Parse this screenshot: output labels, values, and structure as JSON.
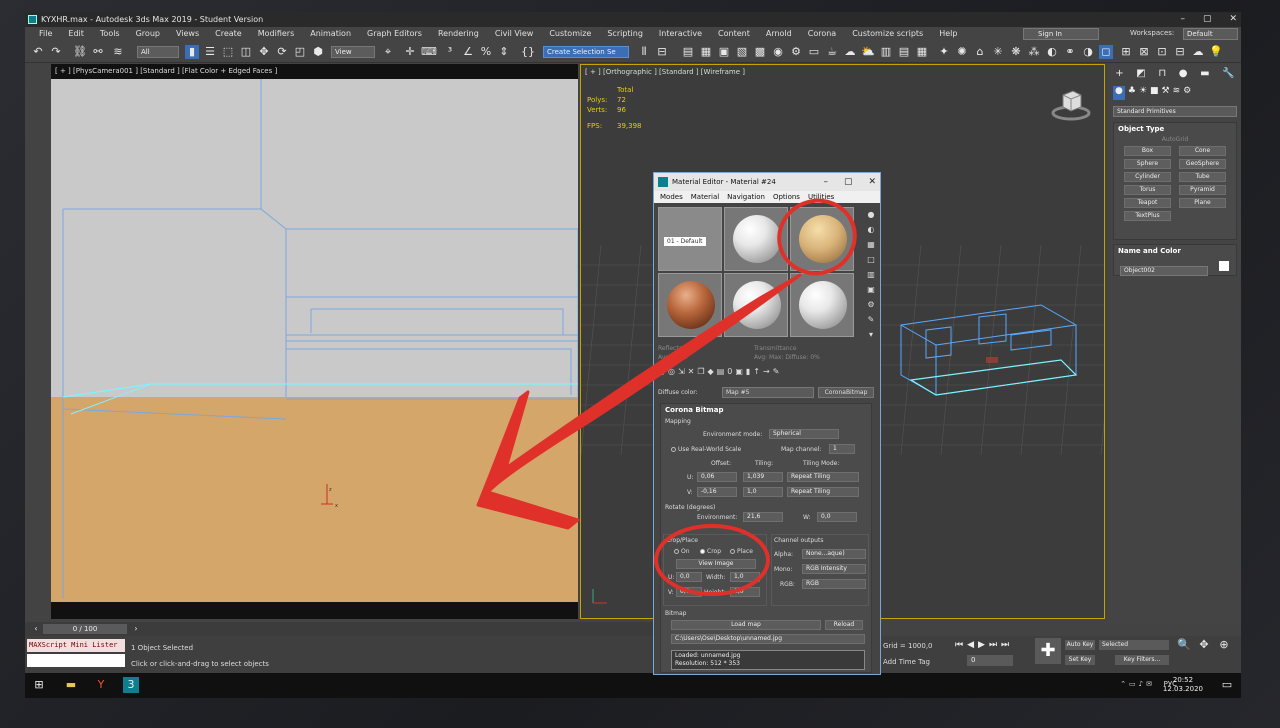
{
  "window": {
    "title": "KYXHR.max - Autodesk 3ds Max 2019 - Student Version",
    "minimize": "–",
    "maximize": "▢",
    "close": "✕"
  },
  "menu": [
    "File",
    "Edit",
    "Tools",
    "Group",
    "Views",
    "Create",
    "Modifiers",
    "Animation",
    "Graph Editors",
    "Rendering",
    "Civil View",
    "Customize",
    "Scripting",
    "Interactive",
    "Content",
    "Arnold",
    "Corona",
    "Customize scripts",
    "Help"
  ],
  "account": {
    "sign_in": "Sign In",
    "workspaces_label": "Workspaces:",
    "workspace": "Default"
  },
  "toolbar": {
    "filter": "All",
    "view": "View",
    "selection_set": "Create Selection Se"
  },
  "viewport_left": {
    "label": "[ + ] [PhysCamera001 ] [Standard ] [Flat Color + Edged Faces ]"
  },
  "viewport_right": {
    "label": "[ + ] [Orthographic ] [Standard ] [Wireframe ]",
    "stats": {
      "total": "Total",
      "polys_label": "Polys:",
      "polys": "72",
      "verts_label": "Verts:",
      "verts": "96",
      "fps_label": "FPS:",
      "fps": "39,398"
    }
  },
  "command_panel": {
    "category": "Standard Primitives",
    "object_type_title": "Object Type",
    "autogrid": "AutoGrid",
    "objects": [
      "Box",
      "Cone",
      "Sphere",
      "GeoSphere",
      "Cylinder",
      "Tube",
      "Torus",
      "Pyramid",
      "Teapot",
      "Plane",
      "TextPlus"
    ],
    "name_color_title": "Name and Color",
    "object_name": "Object002"
  },
  "material_editor": {
    "title": "Material Editor - Material #24",
    "menu": [
      "Modes",
      "Material",
      "Navigation",
      "Options",
      "Utilities"
    ],
    "slot_default_label": "01 - Default",
    "faded_left": "Reflectance",
    "faded_left_sub": "Avg:     Max:",
    "faded_right": "Transmittance",
    "faded_right_sub": "Avg:     Max:     Diffuse: 0%",
    "diffuse_label": "Diffuse color:",
    "map_name": "Map #5",
    "map_type": "CoronaBitmap",
    "rollout_title": "Corona Bitmap",
    "mapping_label": "Mapping",
    "env_mode_label": "Environment mode:",
    "env_mode": "Spherical",
    "real_world": "Use Real-World Scale",
    "map_channel_label": "Map channel:",
    "map_channel": "1",
    "offset_label": "Offset:",
    "tiling_label": "Tiling:",
    "tiling_mode_label": "Tiling Mode:",
    "u_label": "U:",
    "u_offset": "0,06",
    "u_tiling": "1,039",
    "u_mode": "Repeat Tiling",
    "v_label": "V:",
    "v_offset": "-0,16",
    "v_tiling": "1,0",
    "v_mode": "Repeat Tiling",
    "rotate_label": "Rotate (degrees)",
    "environment_label": "Environment:",
    "environment": "21,6",
    "w_label": "W:",
    "w_value": "0,0",
    "crop_title": "Crop/Place",
    "crop_on": "On",
    "crop_crop": "Crop",
    "crop_place": "Place",
    "view_image": "View Image",
    "crop_u": "0,0",
    "width_label": "Width:",
    "width": "1,0",
    "crop_v": "0,0",
    "height_label": "Height:",
    "height": "1,0",
    "channel_title": "Channel outputs",
    "alpha_label": "Alpha:",
    "alpha": "None...aque)",
    "mono_label": "Mono:",
    "mono": "RGB Intensity",
    "rgb_label": "RGB:",
    "rgb": "RGB",
    "bitmap_title": "Bitmap",
    "load_map": "Load map",
    "reload": "Reload",
    "path": "C:\\Users\\Ose\\Desktop\\unnamed.jpg",
    "loaded": "Loaded: unnamed.jpg",
    "resolution": "Resolution: 512 * 353"
  },
  "timeline": {
    "frame": "0 / 100"
  },
  "status": {
    "maxscript": "MAXScript Mini Lister",
    "selected": "1 Object Selected",
    "hint": "Click or click-and-drag to select objects",
    "grid": "Grid = 1000,0",
    "add_time_tag": "Add Time Tag",
    "frame_value": "0",
    "auto_key": "Auto Key",
    "set_key": "Set Key",
    "selected_dd": "Selected",
    "key_filters": "Key Filters..."
  },
  "taskbar": {
    "lang": "РУС",
    "time": "20:52",
    "date": "12.03.2020"
  },
  "colors": {
    "annotation": "#e0302a",
    "ui_bg": "#434343",
    "floor": "#d4a66a",
    "wire": "#5aa9ff",
    "stats": "#e4d100",
    "accent": "#3a6fb7"
  }
}
